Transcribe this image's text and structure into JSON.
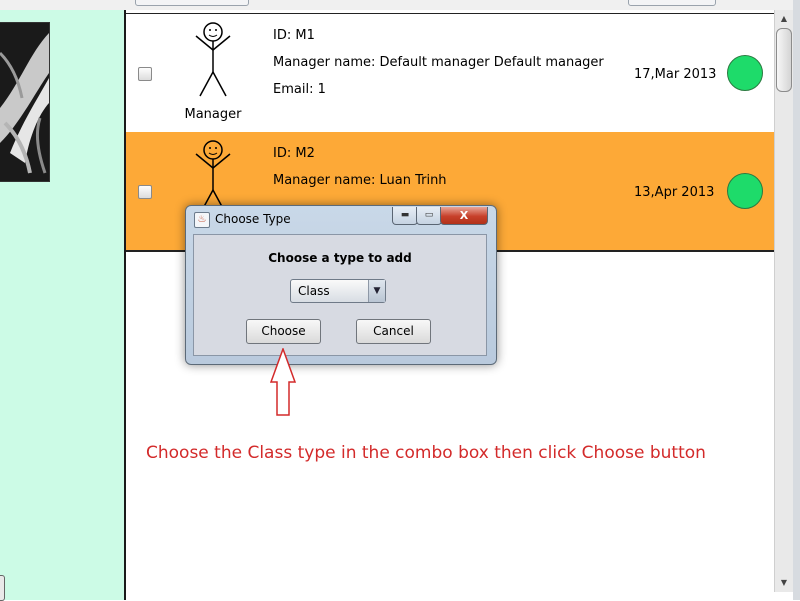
{
  "rows": [
    {
      "role": "Manager",
      "id_line": "ID: M1",
      "name_line": "Manager name: Default manager Default manager",
      "email_line": "Email: 1",
      "date": "17,Mar 2013",
      "status_color": "#1edb6a",
      "row_color": "#ffffff"
    },
    {
      "role": "",
      "id_line": "ID: M2",
      "name_line": "Manager name: Luan Trinh",
      "email_line": "",
      "date": "13,Apr 2013",
      "status_color": "#1edb6a",
      "row_color": "#fda937"
    }
  ],
  "dialog": {
    "title": "Choose Type",
    "prompt": "Choose a type to add",
    "selected_type": "Class",
    "choose_label": "Choose",
    "cancel_label": "Cancel",
    "minimize_glyph": "▬",
    "maximize_glyph": "▭",
    "close_glyph": "X"
  },
  "annotation": {
    "instruction": "Choose the Class type in the combo box then click Choose button",
    "color": "#d32a2a"
  },
  "colors": {
    "left_panel": "#ccfbe6",
    "highlight_row": "#fda937"
  }
}
